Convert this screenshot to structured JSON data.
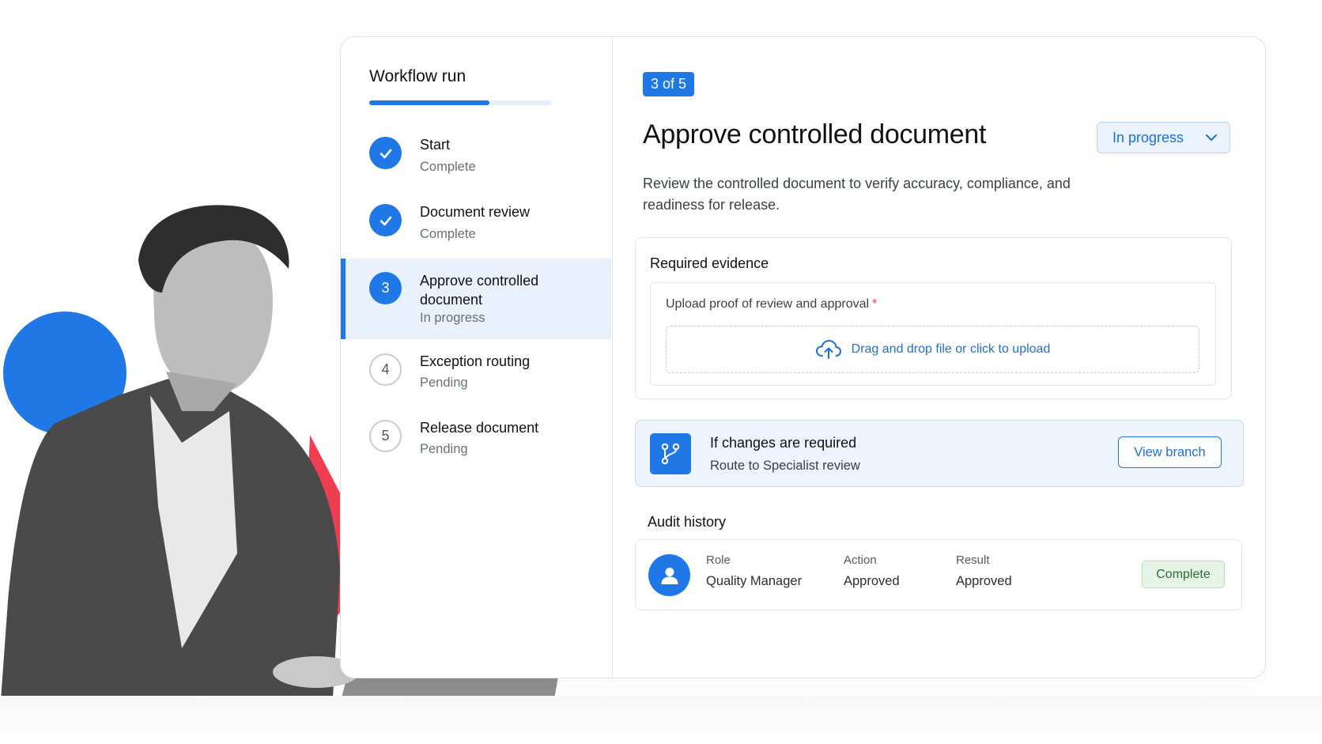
{
  "colors": {
    "accent": "#1f78e6",
    "accent_light": "#e8f1fc",
    "success_bg": "#e6f4e8",
    "success_text": "#2b6b35",
    "required": "#e5484d",
    "decor_red": "#ef3e52"
  },
  "sidebar": {
    "title": "Workflow run",
    "progress": 0.66,
    "steps": [
      {
        "number": "1",
        "label": "Start",
        "status": "Complete",
        "state": "done",
        "icon": "check-icon"
      },
      {
        "number": "2",
        "label": "Document review",
        "status": "Complete",
        "state": "done",
        "icon": "check-icon"
      },
      {
        "number": "3",
        "label": "Approve controlled document",
        "status": "In progress",
        "state": "active"
      },
      {
        "number": "4",
        "label": "Exception routing",
        "status": "Pending",
        "state": "pending"
      },
      {
        "number": "5",
        "label": "Release document",
        "status": "Pending",
        "state": "pending"
      }
    ]
  },
  "main": {
    "step_badge": "3 of 5",
    "title": "Approve controlled document",
    "status_select": {
      "value": "In progress",
      "icon": "chevron-down-icon"
    },
    "description": "Review the controlled document to verify accuracy, compliance, and readiness for release.",
    "evidence": {
      "heading": "Required evidence",
      "field_label": "Upload proof of review and approval",
      "required_marker": "*",
      "dropzone_text": "Drag and drop file or click to upload",
      "dropzone_icon": "cloud-upload-icon"
    },
    "branch": {
      "icon": "git-branch-icon",
      "heading": "If changes are required",
      "subtext": "Route to Specialist review",
      "button_label": "View branch"
    },
    "audit": {
      "heading": "Audit history",
      "entries": [
        {
          "avatar_icon": "user-icon",
          "role_label": "Role",
          "role": "Quality Manager",
          "action_label": "Action",
          "action": "Approved",
          "result_label": "Result",
          "result": "Approved",
          "status": "Complete"
        }
      ]
    }
  }
}
